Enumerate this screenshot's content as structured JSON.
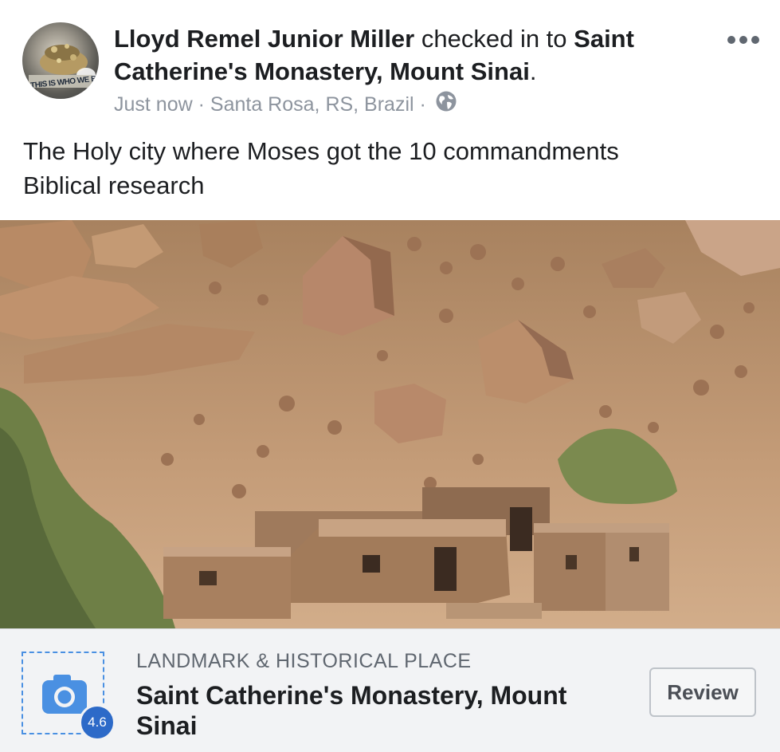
{
  "post": {
    "author": "Lloyd Remel Junior Miller",
    "action": " checked in to ",
    "place": "Saint Catherine's Monastery, Mount Sinai",
    "period": ".",
    "time": "Just now",
    "location": "Santa Rosa, RS, Brazil",
    "separator": "·",
    "privacy_icon": "globe-icon",
    "text_line1": "The Holy city where Moses got the 10 commandments",
    "text_line2": "Biblical research",
    "avatar_caption": "THIS IS WHO WE B"
  },
  "footer": {
    "category": "LANDMARK & HISTORICAL PLACE",
    "place_name": "Saint Catherine's Monastery, Mount Sinai",
    "rating": "4.6",
    "review_label": "Review",
    "camera_icon": "camera-icon"
  },
  "colors": {
    "accent": "#4a90e2",
    "rating_badge": "#2d6ac8",
    "meta_gray": "#8d949e",
    "footer_bg": "#f2f3f5"
  }
}
